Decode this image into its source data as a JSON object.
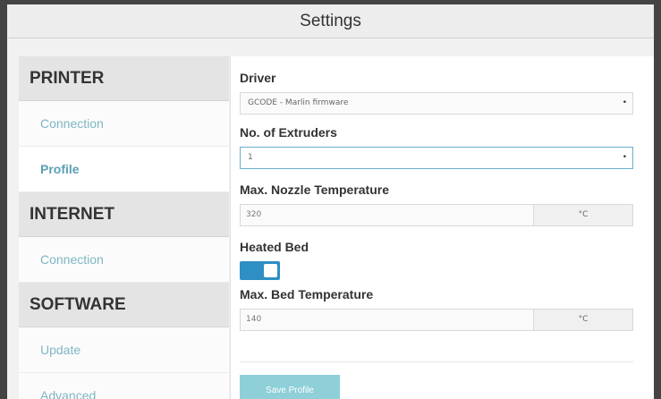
{
  "window": {
    "title": "Settings"
  },
  "sidebar": {
    "sections": [
      {
        "header": "PRINTER",
        "items": [
          "Connection",
          "Profile"
        ]
      },
      {
        "header": "INTERNET",
        "items": [
          "Connection"
        ]
      },
      {
        "header": "SOFTWARE",
        "items": [
          "Update",
          "Advanced"
        ]
      }
    ],
    "active_item": "Profile"
  },
  "profile": {
    "driver_label": "Driver",
    "driver_value": "GCODE - Marlin firmware",
    "extruders_label": "No. of Extruders",
    "extruders_value": "1",
    "nozzle_label": "Max. Nozzle Temperature",
    "nozzle_value": "320",
    "nozzle_unit": "°C",
    "heated_bed_label": "Heated Bed",
    "heated_bed_on": true,
    "bed_label": "Max. Bed Temperature",
    "bed_value": "140",
    "bed_unit": "°C",
    "save_label": "Save Profile"
  },
  "colors": {
    "accent": "#2e8fc2",
    "link": "#7fb6c4",
    "save_button": "#8ecfd8",
    "frame": "#444444"
  },
  "icons": {
    "dropdown": "dropdown-dot-icon"
  }
}
